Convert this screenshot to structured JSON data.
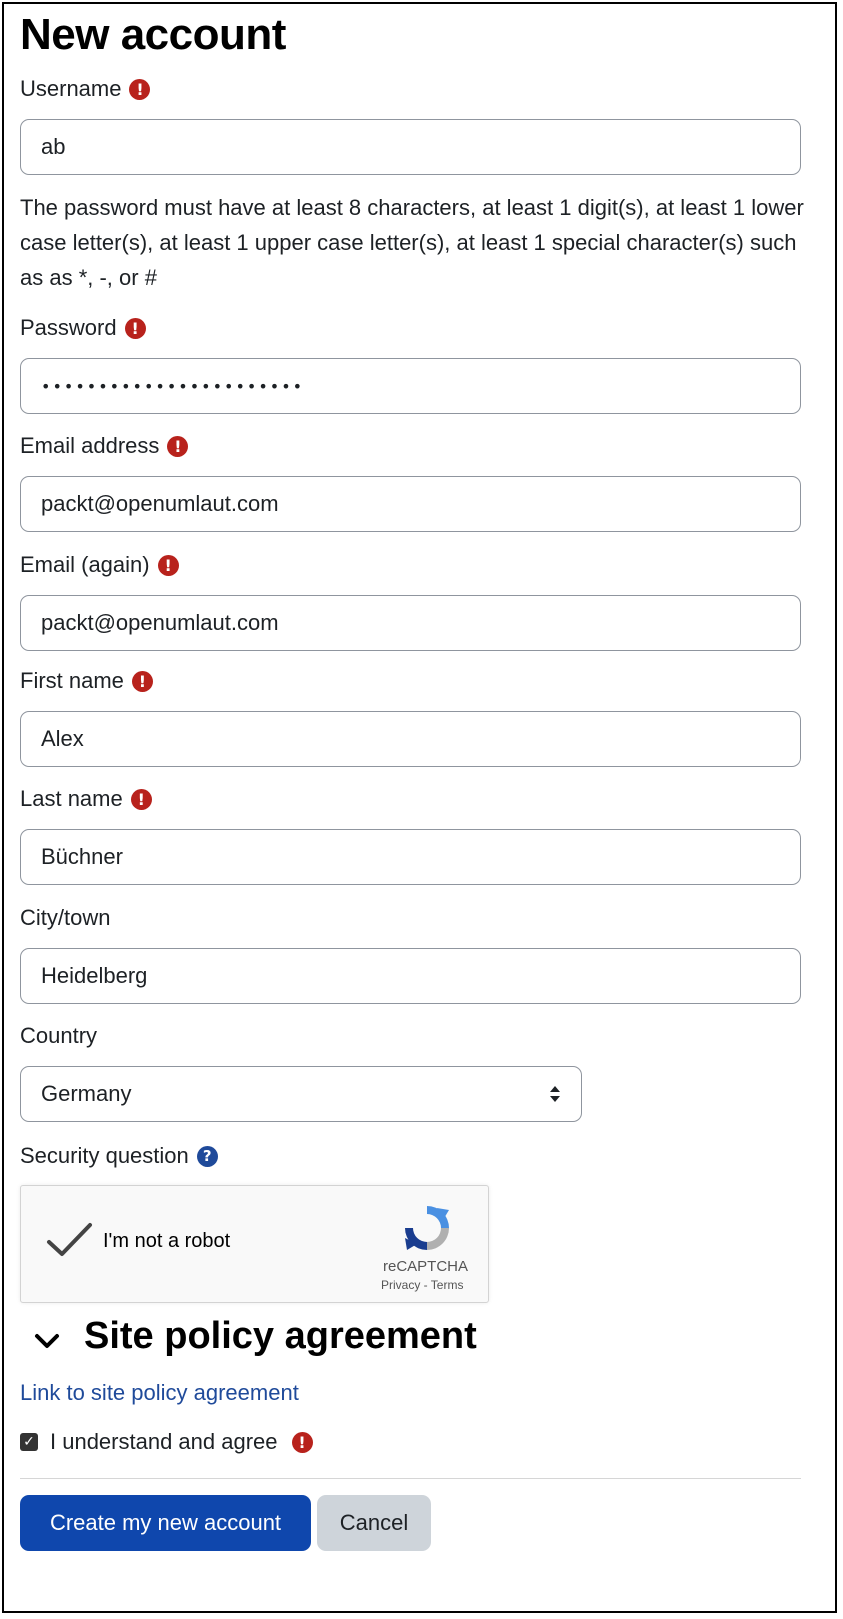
{
  "page": {
    "title": "New account"
  },
  "form": {
    "username": {
      "label": "Username",
      "value": "ab"
    },
    "password_help": "The password must have at least 8 characters, at least 1 digit(s), at least 1 lower case letter(s), at least 1 upper case letter(s), at least 1 special character(s) such as as *, -, or #",
    "password": {
      "label": "Password",
      "value": "•••••••••••••••••••••••"
    },
    "email": {
      "label": "Email address",
      "value": "packt@openumlaut.com"
    },
    "email_again": {
      "label": "Email (again)",
      "value": "packt@openumlaut.com"
    },
    "first_name": {
      "label": "First name",
      "value": "Alex"
    },
    "last_name": {
      "label": "Last name",
      "value": "Büchner"
    },
    "city": {
      "label": "City/town",
      "value": "Heidelberg"
    },
    "country": {
      "label": "Country",
      "value": "Germany"
    },
    "security_question": {
      "label": "Security question"
    }
  },
  "captcha": {
    "label": "I'm not a robot",
    "brand": "reCAPTCHA",
    "links": "Privacy - Terms"
  },
  "policy": {
    "section_title": "Site policy agreement",
    "link": "Link to site policy agreement",
    "agree_label": "I understand and agree"
  },
  "buttons": {
    "create": "Create my new account",
    "cancel": "Cancel"
  },
  "icons": {
    "required": "!",
    "help": "?",
    "checkbox_checked": "✓"
  },
  "colors": {
    "primary": "#0f47ad",
    "required_icon": "#b8221c",
    "help_icon": "#1f4a9a",
    "link": "#1f4a9a"
  }
}
